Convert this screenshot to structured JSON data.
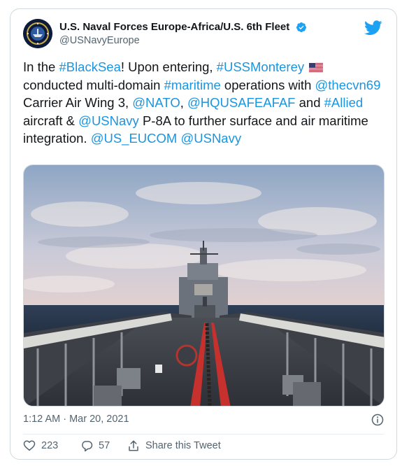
{
  "account": {
    "display_name": "U.S. Naval Forces Europe-Africa/U.S. 6th Fleet",
    "handle": "@USNavyEurope",
    "verified": true,
    "avatar_icon": "navy-seal-avatar-icon"
  },
  "tweet": {
    "segments": [
      {
        "text": "In the ",
        "link": false
      },
      {
        "text": "#BlackSea",
        "link": true
      },
      {
        "text": "! Upon entering, ",
        "link": false
      },
      {
        "text": "#USSMonterey",
        "link": true
      },
      {
        "text": " ",
        "link": false,
        "flag": "us-flag"
      },
      {
        "text": "conducted multi-domain ",
        "link": false
      },
      {
        "text": "#maritime",
        "link": true
      },
      {
        "text": " operations with ",
        "link": false
      },
      {
        "text": "@thecvn69",
        "link": true
      },
      {
        "text": " Carrier Air Wing 3, ",
        "link": false
      },
      {
        "text": "@NATO",
        "link": true
      },
      {
        "text": ", ",
        "link": false
      },
      {
        "text": "@HQUSAFEAFAF",
        "link": true
      },
      {
        "text": " and ",
        "link": false
      },
      {
        "text": "#Allied",
        "link": true
      },
      {
        "text": " aircraft & ",
        "link": false
      },
      {
        "text": "@USNavy",
        "link": true
      },
      {
        "text": " P-8A to further surface and air maritime integration. ",
        "link": false
      },
      {
        "text": "@US_EUCOM",
        "link": true
      },
      {
        "text": " ",
        "link": false
      },
      {
        "text": "@USNavy",
        "link": true
      }
    ],
    "media_description": "bow-of-cruiser-at-sea-photo"
  },
  "meta": {
    "timestamp": "1:12 AM · Mar 20, 2021"
  },
  "actions": {
    "likes": "223",
    "replies": "57",
    "share_label": "Share this Tweet"
  },
  "colors": {
    "link": "#1b95e0",
    "twitter_blue": "#1da1f2",
    "text": "#14171a",
    "muted": "#536471"
  }
}
